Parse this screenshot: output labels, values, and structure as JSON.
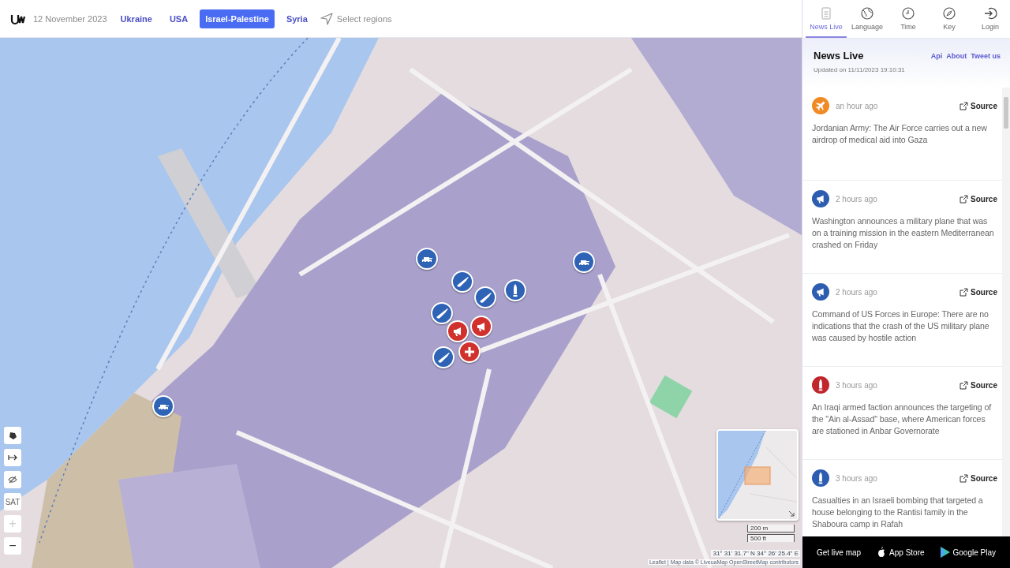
{
  "topbar": {
    "date": "12 November 2023",
    "regions": [
      {
        "label": "Ukraine",
        "selected": false
      },
      {
        "label": "USA",
        "selected": false
      },
      {
        "label": "Israel-Palestine",
        "selected": true
      },
      {
        "label": "Syria",
        "selected": false
      }
    ],
    "select_regions": "Select regions"
  },
  "nav": [
    {
      "label": "News Live",
      "kind": "news",
      "selected": true
    },
    {
      "label": "Language",
      "kind": "globe",
      "selected": false
    },
    {
      "label": "Time",
      "kind": "clock",
      "selected": false
    },
    {
      "label": "Key",
      "kind": "compass",
      "selected": false
    },
    {
      "label": "Login",
      "kind": "login",
      "selected": false
    }
  ],
  "sidebar": {
    "title": "News Live",
    "updated": "Updated on 11/11/2023 19:10:31",
    "links": [
      "Api",
      "About",
      "Tweet us"
    ],
    "items": [
      {
        "kind": "plane",
        "color": "#f08a24",
        "time": "an hour ago",
        "source": "Source",
        "text": "Jordanian Army: The Air Force carries out a new airdrop of medical aid into Gaza"
      },
      {
        "kind": "megaphone",
        "color": "#2d5db0",
        "time": "2 hours ago",
        "source": "Source",
        "text": "Washington announces a military plane that was on a training mission in the eastern Mediterranean crashed on Friday"
      },
      {
        "kind": "megaphone",
        "color": "#2d5db0",
        "time": "2 hours ago",
        "source": "Source",
        "text": "Command of US Forces in Europe: There are no indications that the crash of the US military plane was caused by hostile action"
      },
      {
        "kind": "bullet",
        "color": "#c0262b",
        "time": "3 hours ago",
        "source": "Source",
        "text": "An Iraqi armed faction announces the targeting of the \"Ain al-Assad\" base, where American forces are stationed in Anbar Governorate"
      },
      {
        "kind": "bullet",
        "color": "#2d5db0",
        "time": "3 hours ago",
        "source": "Source",
        "text": "Casualties in an Israeli bombing that targeted a house belonging to the Rantisi family in the Shaboura camp in Rafah"
      }
    ],
    "footer": {
      "get": "Get live map",
      "appstore": "App Store",
      "googleplay": "Google Play"
    }
  },
  "map": {
    "markers": [
      {
        "kind": "tank",
        "color": "#2f63b5"
      },
      {
        "kind": "tank",
        "color": "#2f63b5"
      },
      {
        "kind": "tank",
        "color": "#2f63b5"
      },
      {
        "kind": "rifle",
        "color": "#2f63b5"
      },
      {
        "kind": "rifle",
        "color": "#2f63b5"
      },
      {
        "kind": "rifle",
        "color": "#2f63b5"
      },
      {
        "kind": "rifle",
        "color": "#2f63b5"
      },
      {
        "kind": "bullet",
        "color": "#2f63b5"
      },
      {
        "kind": "megaphone",
        "color": "#d0312d"
      },
      {
        "kind": "megaphone",
        "color": "#d0312d"
      },
      {
        "kind": "medical",
        "color": "#d0312d"
      }
    ],
    "controls": [
      {
        "kind": "polygon",
        "disabled": false
      },
      {
        "kind": "ruler",
        "disabled": false
      },
      {
        "kind": "hide",
        "disabled": false
      },
      {
        "kind": "sat",
        "label": "SAT",
        "disabled": false
      },
      {
        "kind": "zoomin",
        "label": "+",
        "disabled": true
      },
      {
        "kind": "zoomout",
        "label": "−",
        "disabled": false
      }
    ],
    "scale": [
      "200 m",
      "500 ft"
    ],
    "coordinates": "31° 31' 31.7\" N 34° 26' 25.4\" E",
    "attribution": "Leaflet | Map data © LiveuaMap OpenStreetMap contributors"
  }
}
